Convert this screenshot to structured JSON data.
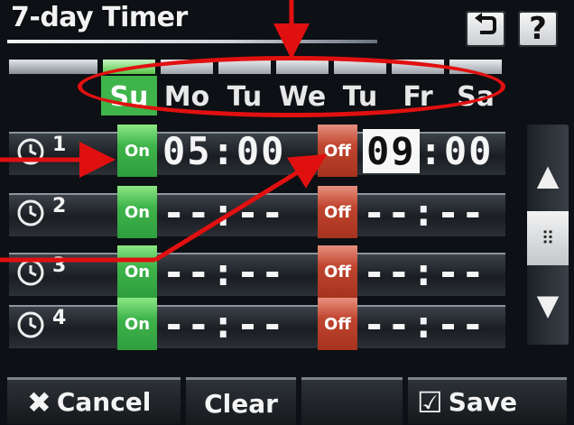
{
  "header": {
    "title": "7-day Timer",
    "back_icon": "back-arrow-icon",
    "help_label": "?"
  },
  "days": [
    {
      "label": "Su",
      "active": true
    },
    {
      "label": "Mo",
      "active": false
    },
    {
      "label": "Tu",
      "active": false
    },
    {
      "label": "We",
      "active": false
    },
    {
      "label": "Tu",
      "active": false
    },
    {
      "label": "Fr",
      "active": false
    },
    {
      "label": "Sa",
      "active": false
    }
  ],
  "rows": [
    {
      "num": "1",
      "on_label": "On",
      "on_time": "05:00",
      "off_label": "Off",
      "off_time_hh": "09",
      "off_time_rest": ":00"
    },
    {
      "num": "2",
      "on_label": "On",
      "on_time": "--:--",
      "off_label": "Off",
      "off_time": "--:--"
    },
    {
      "num": "3",
      "on_label": "On",
      "on_time": "--:--",
      "off_label": "Off",
      "off_time": "--:--"
    },
    {
      "num": "4",
      "on_label": "On",
      "on_time": "--:--",
      "off_label": "Off",
      "off_time": "--:--"
    }
  ],
  "footer": {
    "cancel_label": "Cancel",
    "clear_label": "Clear",
    "save_label": "Save"
  },
  "colors": {
    "on_green": "#3fb44b",
    "off_red": "#c0452f",
    "annotation_red": "#e11010"
  }
}
